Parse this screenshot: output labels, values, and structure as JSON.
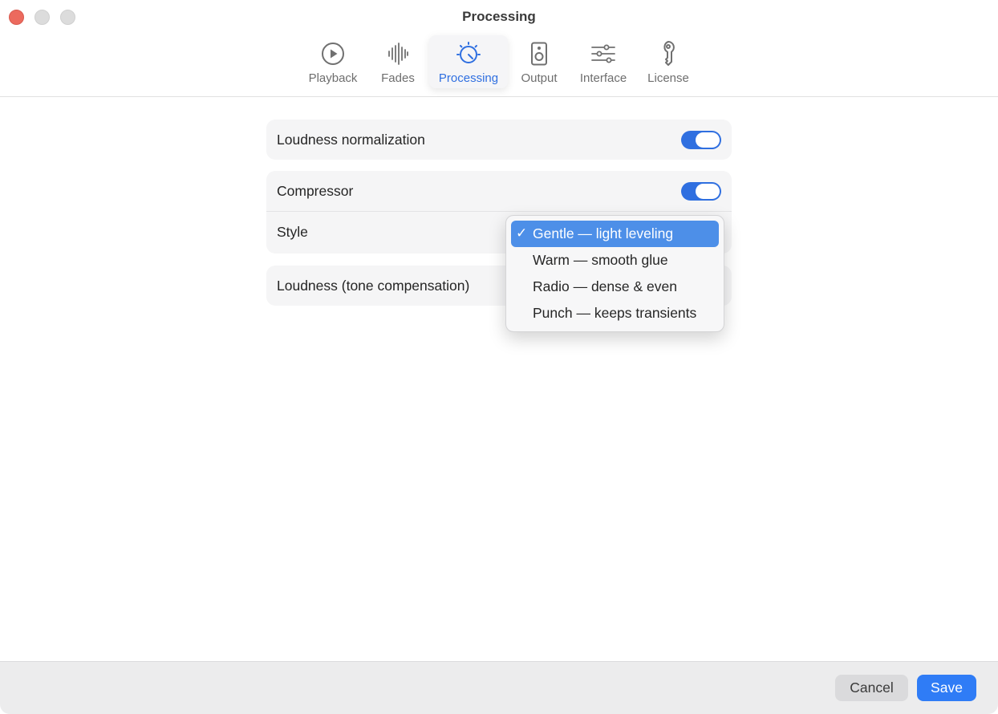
{
  "window": {
    "title": "Processing"
  },
  "tabs": [
    {
      "label": "Playback",
      "icon": "play-circle-icon",
      "active": false
    },
    {
      "label": "Fades",
      "icon": "waveform-icon",
      "active": false
    },
    {
      "label": "Processing",
      "icon": "dial-icon",
      "active": true
    },
    {
      "label": "Output",
      "icon": "speaker-icon",
      "active": false
    },
    {
      "label": "Interface",
      "icon": "sliders-icon",
      "active": false
    },
    {
      "label": "License",
      "icon": "key-icon",
      "active": false
    }
  ],
  "settings": {
    "loudness_normalization": {
      "label": "Loudness normalization",
      "enabled": true
    },
    "compressor": {
      "label": "Compressor",
      "enabled": true
    },
    "style": {
      "label": "Style"
    },
    "tone_compensation": {
      "label": "Loudness (tone compensation)"
    }
  },
  "style_menu": {
    "check_glyph": "✓",
    "options": [
      {
        "label": "Gentle — light leveling",
        "selected": true
      },
      {
        "label": "Warm — smooth glue",
        "selected": false
      },
      {
        "label": "Radio — dense & even",
        "selected": false
      },
      {
        "label": "Punch — keeps transients",
        "selected": false
      }
    ]
  },
  "footer": {
    "cancel_label": "Cancel",
    "save_label": "Save"
  },
  "colors": {
    "accent": "#2f6fe0",
    "save": "#2f7cf6",
    "menu_highlight": "#4d8fe8",
    "close": "#ec6a5e"
  }
}
